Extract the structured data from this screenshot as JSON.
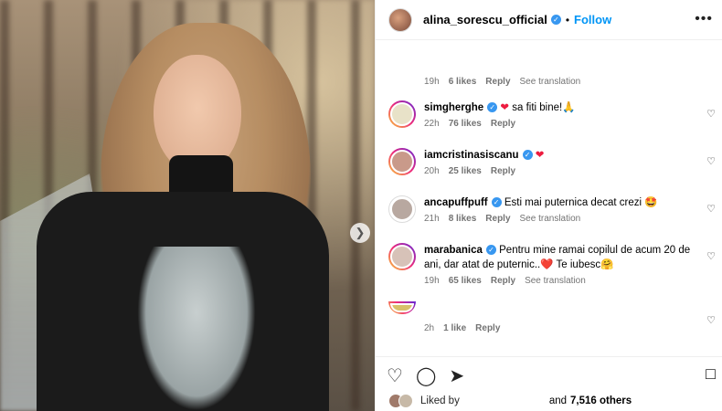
{
  "post": {
    "username": "alina_sorescu_official",
    "follow_label": "Follow",
    "more_label": "•••"
  },
  "top_meta": {
    "time": "19h",
    "likes": "6 likes",
    "reply": "Reply",
    "translate": "See translation"
  },
  "comments": [
    {
      "user": "simgherghe",
      "text": " sa fiti bine!🙏",
      "time": "22h",
      "likes": "76 likes",
      "reply": "Reply",
      "translate": ""
    },
    {
      "user": "iamcristinasiscanu",
      "text": "",
      "time": "20h",
      "likes": "25 likes",
      "reply": "Reply",
      "translate": ""
    },
    {
      "user": "ancapuffpuff",
      "text": " Esti mai puternica decat crezi 🤩",
      "time": "21h",
      "likes": "8 likes",
      "reply": "Reply",
      "translate": "See translation"
    },
    {
      "user": "marabanica",
      "text": " Pentru mine ramai copilul de acum 20 de ani, dar atat de puternic..❤️ Te iubesc🤗",
      "time": "19h",
      "likes": "65 likes",
      "reply": "Reply",
      "translate": "See translation"
    },
    {
      "user": "",
      "text": "",
      "time": "2h",
      "likes": "1 like",
      "reply": "Reply",
      "translate": ""
    }
  ],
  "footer": {
    "liked_by": "Liked by",
    "and": "and",
    "count": "7,516 others"
  },
  "colors": {
    "accent": "#0095f6",
    "verified": "#3897f0",
    "heart": "#ed1c3f"
  }
}
